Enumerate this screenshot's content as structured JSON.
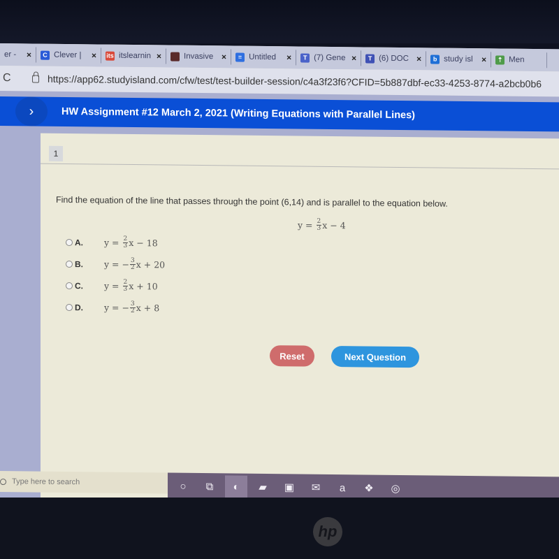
{
  "browser": {
    "tabs": [
      {
        "label": "er -",
        "favicon": "generic-tab-icon",
        "color": "#8a8fa8"
      },
      {
        "label": "Clever |",
        "favicon": "clever-icon",
        "color": "#2a5bd7",
        "glyph": "C"
      },
      {
        "label": "itslearnin",
        "favicon": "itslearning-icon",
        "color": "#d9493a",
        "glyph": "its"
      },
      {
        "label": "Invasive",
        "favicon": "image-thumbnail-icon",
        "color": "#5a2a2a",
        "glyph": ""
      },
      {
        "label": "Untitled",
        "favicon": "google-docs-icon",
        "color": "#2f6fe0",
        "glyph": "≡"
      },
      {
        "label": "(7) Gene",
        "favicon": "teams-icon",
        "color": "#4a62c9",
        "glyph": "T"
      },
      {
        "label": "(6) DOC",
        "favicon": "teams-icon",
        "color": "#3f51b5",
        "glyph": "T"
      },
      {
        "label": "study isl",
        "favicon": "bing-icon",
        "color": "#1f6fd6",
        "glyph": "b"
      },
      {
        "label": "Men",
        "favicon": "study-island-icon",
        "color": "#4f9b4a",
        "glyph": "⇡"
      }
    ],
    "close_glyph": "×",
    "reload_glyph": "C",
    "url": "https://app62.studyisland.com/cfw/test/test-builder-session/c4a3f23f6?CFID=5b887dbf-ec33-4253-8774-a2bcb0b6"
  },
  "header": {
    "nav_glyph": "›",
    "title": "HW Assignment #12 March 2, 2021 (Writing Equations with Parallel Lines)"
  },
  "question": {
    "number": "1",
    "prompt": "Find the equation of the line that passes through the point (6,14) and is parallel to the equation below.",
    "given_equation": {
      "lhs": "y",
      "eq": "=",
      "sign": "",
      "num": "2",
      "den": "3",
      "var": "x",
      "rest": "− 4"
    },
    "options": [
      {
        "letter": "A.",
        "lhs": "y",
        "eq": "=",
        "sign": "",
        "num": "2",
        "den": "3",
        "var": "x",
        "rest": "− 18"
      },
      {
        "letter": "B.",
        "lhs": "y",
        "eq": "=",
        "sign": "−",
        "num": "3",
        "den": "2",
        "var": "x",
        "rest": "+ 20"
      },
      {
        "letter": "C.",
        "lhs": "y",
        "eq": "=",
        "sign": "",
        "num": "2",
        "den": "3",
        "var": "x",
        "rest": "+ 10"
      },
      {
        "letter": "D.",
        "lhs": "y",
        "eq": "=",
        "sign": "−",
        "num": "3",
        "den": "2",
        "var": "x",
        "rest": "+ 8"
      }
    ]
  },
  "actions": {
    "reset_label": "Reset",
    "next_label": "Next Question",
    "reset_color": "#cf6c6c",
    "next_color": "#2e95de"
  },
  "taskbar": {
    "search_placeholder": "Type here to search",
    "icons": [
      {
        "name": "cortana-icon",
        "glyph": "○"
      },
      {
        "name": "task-view-icon",
        "glyph": "⧉"
      },
      {
        "name": "edge-icon",
        "glyph": "◐"
      },
      {
        "name": "file-explorer-icon",
        "glyph": "▰"
      },
      {
        "name": "store-icon",
        "glyph": "▣"
      },
      {
        "name": "mail-icon",
        "glyph": "✉"
      },
      {
        "name": "amazon-icon",
        "glyph": "a"
      },
      {
        "name": "dropbox-icon",
        "glyph": "❖"
      },
      {
        "name": "app-icon",
        "glyph": "◎"
      }
    ]
  },
  "device": {
    "brand": "hp"
  }
}
